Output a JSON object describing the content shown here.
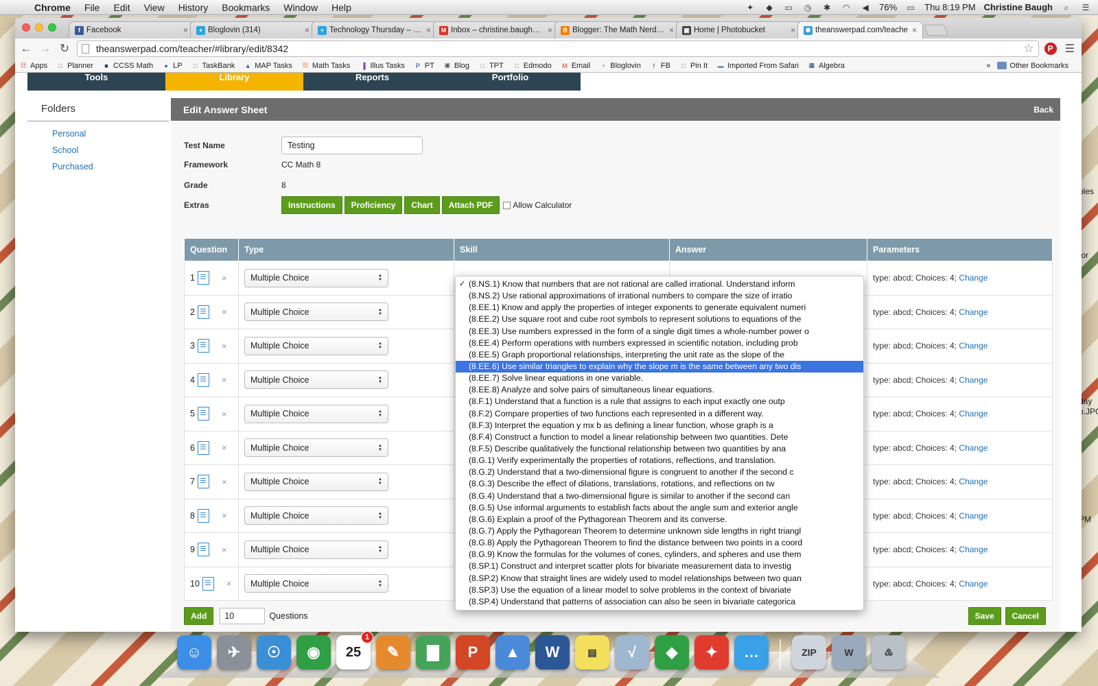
{
  "menubar": {
    "app": "Chrome",
    "items": [
      "File",
      "Edit",
      "View",
      "History",
      "Bookmarks",
      "Window",
      "Help"
    ],
    "battery": "76%",
    "clock": "Thu 8:19 PM",
    "user": "Christine Baugh"
  },
  "tabs": [
    {
      "title": "Facebook",
      "favicon": "f",
      "color": "#3b5998"
    },
    {
      "title": "Bloglovin (314)",
      "favicon": "+",
      "color": "#2aa4e2"
    },
    {
      "title": "Technology Thursday – Ke",
      "favicon": "+",
      "color": "#2aa4e2"
    },
    {
      "title": "Inbox – christine.baugh@v",
      "favicon": "M",
      "color": "#d93025"
    },
    {
      "title": "Blogger: The Math Nerdett",
      "favicon": "B",
      "color": "#f57d00"
    },
    {
      "title": "Home | Photobucket",
      "favicon": "▣",
      "color": "#444444"
    },
    {
      "title": "theanswerpad.com/teache",
      "favicon": "✺",
      "color": "#3aa0d8"
    }
  ],
  "url": "theanswerpad.com/teacher/#library/edit/8342",
  "bookmarks": [
    {
      "label": "Apps",
      "icon": "☷",
      "color": "#c0392b"
    },
    {
      "label": "Planner",
      "icon": "□",
      "color": "#777777"
    },
    {
      "label": "CCSS Math",
      "icon": "■",
      "color": "#1b3a7a"
    },
    {
      "label": "LP",
      "icon": "●",
      "color": "#2c6fb5"
    },
    {
      "label": "TaskBank",
      "icon": "□",
      "color": "#777777"
    },
    {
      "label": "MAP Tasks",
      "icon": "▲",
      "color": "#2c6fb5"
    },
    {
      "label": "Math Tasks",
      "icon": "☷",
      "color": "#d35400"
    },
    {
      "label": "Illus Tasks",
      "icon": "▐",
      "color": "#8e44ad"
    },
    {
      "label": "PT",
      "icon": "P",
      "color": "#1b3a7a"
    },
    {
      "label": "Blog",
      "icon": "▣",
      "color": "#555555"
    },
    {
      "label": "TPT",
      "icon": "□",
      "color": "#888888"
    },
    {
      "label": "Edmodo",
      "icon": "□",
      "color": "#777777"
    },
    {
      "label": "Email",
      "icon": "M",
      "color": "#d93025"
    },
    {
      "label": "Bloglovin",
      "icon": "+",
      "color": "#2aa4e2"
    },
    {
      "label": "FB",
      "icon": "f",
      "color": "#3b5998"
    },
    {
      "label": "Pin It",
      "icon": "□",
      "color": "#777777"
    },
    {
      "label": "Imported From Safari",
      "icon": "▬",
      "color": "#6b8fb8"
    },
    {
      "label": "Algebra",
      "icon": "▦",
      "color": "#1b3a7a"
    }
  ],
  "bookmarks_more": "»",
  "other_bookmarks": "Other Bookmarks",
  "topnav": [
    "Tools",
    "Library",
    "Reports",
    "Portfolio"
  ],
  "sidebar": {
    "title": "Folders",
    "items": [
      "Personal",
      "School",
      "Purchased"
    ]
  },
  "panel": {
    "title": "Edit Answer Sheet",
    "back": "Back"
  },
  "form": {
    "test_name_label": "Test Name",
    "test_name": "Testing",
    "framework_label": "Framework",
    "framework": "CC Math 8",
    "grade_label": "Grade",
    "grade": "8",
    "extras_label": "Extras",
    "extras": [
      "Instructions",
      "Proficiency",
      "Chart",
      "Attach PDF"
    ],
    "calculator": "Allow Calculator"
  },
  "table": {
    "headers": [
      "Question",
      "Type",
      "Skill",
      "Answer",
      "Parameters"
    ],
    "rows": [
      {
        "num": "1",
        "type": "Multiple Choice",
        "params": "type: abcd; Choices: 4;",
        "change": "Change"
      },
      {
        "num": "2",
        "type": "Multiple Choice",
        "params": "type: abcd; Choices: 4;",
        "change": "Change"
      },
      {
        "num": "3",
        "type": "Multiple Choice",
        "params": "type: abcd; Choices: 4;",
        "change": "Change"
      },
      {
        "num": "4",
        "type": "Multiple Choice",
        "params": "type: abcd; Choices: 4;",
        "change": "Change"
      },
      {
        "num": "5",
        "type": "Multiple Choice",
        "params": "type: abcd; Choices: 4;",
        "change": "Change"
      },
      {
        "num": "6",
        "type": "Multiple Choice",
        "params": "type: abcd; Choices: 4;",
        "change": "Change"
      },
      {
        "num": "7",
        "type": "Multiple Choice",
        "params": "type: abcd; Choices: 4;",
        "change": "Change"
      },
      {
        "num": "8",
        "type": "Multiple Choice",
        "params": "type: abcd; Choices: 4;",
        "change": "Change"
      },
      {
        "num": "9",
        "type": "Multiple Choice",
        "params": "type: abcd; Choices: 4;",
        "change": "Change"
      },
      {
        "num": "10",
        "type": "Multiple Choice",
        "params": "type: abcd; Choices: 4;",
        "change": "Change"
      }
    ]
  },
  "footer": {
    "add": "Add",
    "qty": "10",
    "questions": "Questions",
    "save": "Save",
    "cancel": "Cancel"
  },
  "skills": {
    "checked_index": 0,
    "highlighted_index": 7,
    "options": [
      "(8.NS.1) Know that numbers that are not rational are called irrational. Understand inform",
      "(8.NS.2) Use rational approximations of irrational numbers to compare the size of irratio",
      "(8.EE.1) Know and apply the properties of integer exponents to generate equivalent numeri",
      "(8.EE.2) Use square root and cube root symbols to represent solutions to equations of the",
      "(8.EE.3) Use numbers expressed in the form of a single digit times a whole-number power o",
      "(8.EE.4) Perform operations with numbers expressed in scientific notation, including prob",
      "(8.EE.5) Graph proportional relationships, interpreting the unit rate as the slope of the",
      "(8.EE.6) Use similar triangles to explain why the slope m is the same between any two dis",
      "(8.EE.7) Solve linear equations in one variable.",
      "(8.EE.8) Analyze and solve pairs of simultaneous linear equations.",
      "(8.F.1) Understand that a function is a rule that assigns to each input exactly one outp",
      "(8.F.2) Compare properties of two functions each represented in a different way.",
      "(8.F.3) Interpret the equation y mx b as defining a linear function, whose graph is a",
      "(8.F.4) Construct a function to model a linear relationship between two quantities. Dete",
      "(8.F.5) Describe qualitatively the functional relationship between two quantities by ana",
      "(8.G.1) Verify experimentally the properties of rotations, reflections, and translation.",
      "(8.G.2) Understand that a two-dimensional figure is congruent to another if the second c",
      "(8.G.3) Describe the effect of dilations, translations, rotations, and reflections on tw",
      "(8.G.4) Understand that a two-dimensional figure is similar to another if the second can",
      "(8.G.5) Use informal arguments to establish facts about the angle sum and exterior angle",
      "(8.G.6) Explain a proof of the Pythagorean Theorem and its converse.",
      "(8.G.7) Apply the Pythagorean Theorem to determine unknown side lengths in right triangl",
      "(8.G.8) Apply the Pythagorean Theorem to find the distance between two points in a coord",
      "(8.G.9) Know the formulas for the volumes of cones, cylinders, and spheres and use them",
      "(8.SP.1) Construct and interpret scatter plots for bivariate measurement data to investig",
      "(8.SP.2) Know that straight lines are widely used to model relationships between two quan",
      "(8.SP.3) Use the equation of a linear model to solve problems in the context of bivariate",
      "(8.SP.4) Understand that patterns of association can also be seen in bivariate categorica"
    ]
  },
  "desktop": {
    "label1": "bles",
    "label2": "for",
    "label3a": "day",
    "label3b": "o.JPG",
    "label4": "PM"
  },
  "dock": [
    {
      "name": "finder",
      "label": "☺",
      "color": "#3d8ee6"
    },
    {
      "name": "launchpad",
      "label": "✈",
      "color": "#8a8f98"
    },
    {
      "name": "safari",
      "label": "☉",
      "color": "#3a8fd6"
    },
    {
      "name": "chrome",
      "label": "◉",
      "color": "#2f9e44"
    },
    {
      "name": "calendar",
      "label": "25",
      "color": "#ffffff",
      "badge": "1"
    },
    {
      "name": "pages",
      "label": "✎",
      "color": "#e68a2e"
    },
    {
      "name": "numbers",
      "label": "▇",
      "color": "#46a35a"
    },
    {
      "name": "powerpoint",
      "label": "P",
      "color": "#d24726"
    },
    {
      "name": "keynote",
      "label": "▲",
      "color": "#4a8ad8"
    },
    {
      "name": "word",
      "label": "W",
      "color": "#2b5797"
    },
    {
      "name": "stickies",
      "label": "▤",
      "color": "#f3df5b"
    },
    {
      "name": "grapher",
      "label": "√",
      "color": "#9fb7cf"
    },
    {
      "name": "sims",
      "label": "◆",
      "color": "#2f9e44"
    },
    {
      "name": "acrobat",
      "label": "✦",
      "color": "#e03b2e"
    },
    {
      "name": "messages",
      "label": "…",
      "color": "#3aa0e8"
    },
    {
      "name": "zip",
      "label": "ZIP",
      "color": "#cfd5dc"
    },
    {
      "name": "document",
      "label": "W",
      "color": "#9aaabc"
    },
    {
      "name": "trash",
      "label": "♳",
      "color": "#b9c0c8"
    }
  ]
}
